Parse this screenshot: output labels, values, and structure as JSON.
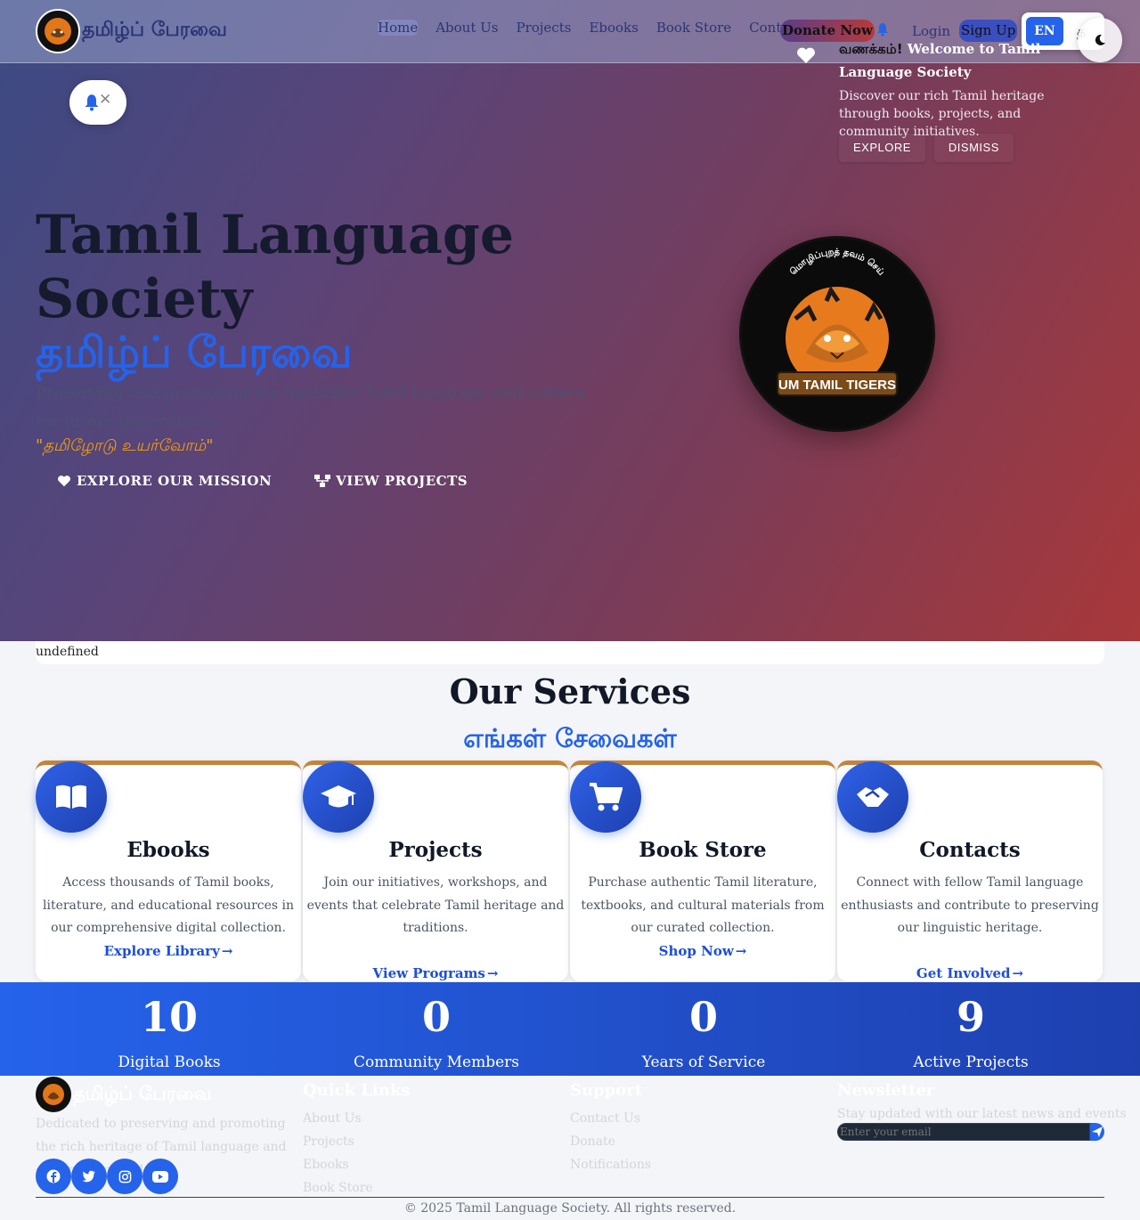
{
  "nav": {
    "brand": "தமிழ்ப் பேரவை",
    "links": [
      "Home",
      "About Us",
      "Projects",
      "Ebooks",
      "Book Store",
      "Contact Us"
    ],
    "donate": "Donate Now",
    "login": "Login",
    "signup": "Sign Up",
    "lang_en": "EN",
    "lang_ta": "த"
  },
  "welcome": {
    "title_ta": "வணக்கம்!",
    "title_en": " Welcome to Tamil Language Society",
    "text": "Discover our rich Tamil heritage through books, projects, and community initiatives.",
    "explore": "EXPLORE",
    "dismiss": "DISMISS"
  },
  "hero": {
    "title": "Tamil Language Society",
    "title_ta": "தமிழ்ப் பேரவை",
    "subtitle": "Preserving and promoting the beautiful Tamil language and culture for future generations",
    "quote": "\"தமிழோடு உயர்வோம்\"",
    "btn_mission": "EXPLORE OUR MISSION",
    "btn_projects": "VIEW PROJECTS",
    "logo_arc": "மொழிப்புறத் தவம் செய்",
    "logo_name": "UM TAMIL TIGERS"
  },
  "image_alt": "undefined",
  "services": {
    "title": "Our Services",
    "title_ta": "எங்கள் சேவைகள்",
    "cards": [
      {
        "title": "Ebooks",
        "desc": "Access thousands of Tamil books, literature, and educational resources in our comprehensive digital collection.",
        "link": "Explore Library",
        "icon": "book-icon"
      },
      {
        "title": "Projects",
        "desc": "Join our initiatives, workshops, and events that celebrate Tamil heritage and traditions.",
        "link": "View Programs",
        "icon": "graduation-cap-icon"
      },
      {
        "title": "Book Store",
        "desc": "Purchase authentic Tamil literature, textbooks, and cultural materials from our curated collection.",
        "link": "Shop Now",
        "icon": "cart-icon"
      },
      {
        "title": "Contacts",
        "desc": "Connect with fellow Tamil language enthusiasts and contribute to preserving our linguistic heritage.",
        "link": "Get Involved",
        "icon": "handshake-icon"
      }
    ]
  },
  "stats": [
    {
      "num": "10",
      "label": "Digital Books"
    },
    {
      "num": "0",
      "label": "Community Members"
    },
    {
      "num": "0",
      "label": "Years of Service"
    },
    {
      "num": "9",
      "label": "Active Projects"
    }
  ],
  "footer": {
    "brand": "தமிழ்ப் பேரவை",
    "desc": "Dedicated to preserving and promoting the rich heritage of Tamil language and culture worldwide.",
    "quick_title": "Quick Links",
    "quick_links": [
      "About Us",
      "Projects",
      "Ebooks",
      "Book Store"
    ],
    "support_title": "Support",
    "support_links": [
      "Contact Us",
      "Donate",
      "Notifications"
    ],
    "news_title": "Newsletter",
    "news_text": "Stay updated with our latest news and events",
    "email_placeholder": "Enter your email",
    "copyright": "© 2025 Tamil Language Society. All rights reserved."
  },
  "colors": {
    "accent": "#2563eb",
    "gold": "#f59e0b",
    "hero_start": "#3b4a84",
    "hero_end": "#a8383a"
  }
}
